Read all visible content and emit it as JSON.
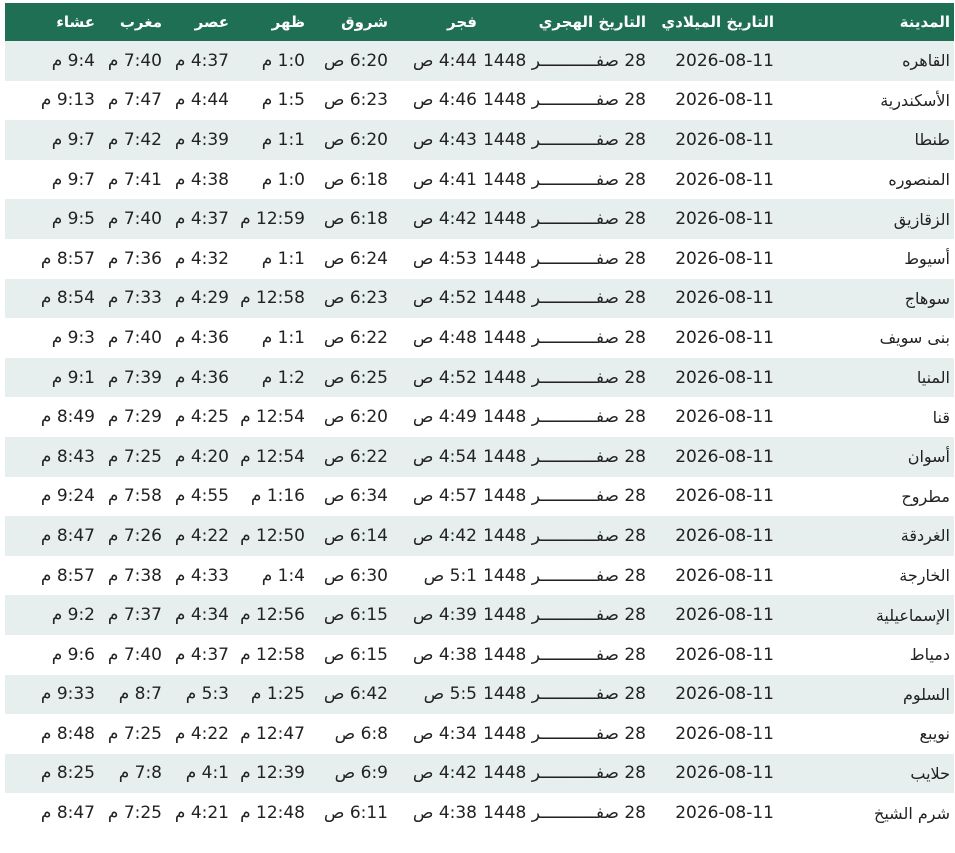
{
  "table": {
    "headers": {
      "city": "المدينة",
      "greg": "التاريخ الميلادي",
      "hijri": "التاريخ الهجري",
      "fajr": "فجر",
      "shuruq": "شروق",
      "dhuhr": "ظهر",
      "asr": "عصر",
      "maghrib": "مغرب",
      "isha": "عشاء"
    },
    "rows": [
      {
        "city": "القاهره",
        "greg": "2026-08-11",
        "hijri": "28 صفـــــــــــر 1448",
        "fajr": "4:44 ص",
        "shuruq": "6:20 ص",
        "dhuhr": "1:0 م",
        "asr": "4:37 م",
        "maghrib": "7:40 م",
        "isha": "9:4 م"
      },
      {
        "city": "الأسكندرية",
        "greg": "2026-08-11",
        "hijri": "28 صفـــــــــــر 1448",
        "fajr": "4:46 ص",
        "shuruq": "6:23 ص",
        "dhuhr": "1:5 م",
        "asr": "4:44 م",
        "maghrib": "7:47 م",
        "isha": "9:13 م"
      },
      {
        "city": "طنطا",
        "greg": "2026-08-11",
        "hijri": "28 صفـــــــــــر 1448",
        "fajr": "4:43 ص",
        "shuruq": "6:20 ص",
        "dhuhr": "1:1 م",
        "asr": "4:39 م",
        "maghrib": "7:42 م",
        "isha": "9:7 م"
      },
      {
        "city": "المنصوره",
        "greg": "2026-08-11",
        "hijri": "28 صفـــــــــــر 1448",
        "fajr": "4:41 ص",
        "shuruq": "6:18 ص",
        "dhuhr": "1:0 م",
        "asr": "4:38 م",
        "maghrib": "7:41 م",
        "isha": "9:7 م"
      },
      {
        "city": "الزقازيق",
        "greg": "2026-08-11",
        "hijri": "28 صفـــــــــــر 1448",
        "fajr": "4:42 ص",
        "shuruq": "6:18 ص",
        "dhuhr": "12:59 م",
        "asr": "4:37 م",
        "maghrib": "7:40 م",
        "isha": "9:5 م"
      },
      {
        "city": "أسيوط",
        "greg": "2026-08-11",
        "hijri": "28 صفـــــــــــر 1448",
        "fajr": "4:53 ص",
        "shuruq": "6:24 ص",
        "dhuhr": "1:1 م",
        "asr": "4:32 م",
        "maghrib": "7:36 م",
        "isha": "8:57 م"
      },
      {
        "city": "سوهاج",
        "greg": "2026-08-11",
        "hijri": "28 صفـــــــــــر 1448",
        "fajr": "4:52 ص",
        "shuruq": "6:23 ص",
        "dhuhr": "12:58 م",
        "asr": "4:29 م",
        "maghrib": "7:33 م",
        "isha": "8:54 م"
      },
      {
        "city": "بنى سويف",
        "greg": "2026-08-11",
        "hijri": "28 صفـــــــــــر 1448",
        "fajr": "4:48 ص",
        "shuruq": "6:22 ص",
        "dhuhr": "1:1 م",
        "asr": "4:36 م",
        "maghrib": "7:40 م",
        "isha": "9:3 م"
      },
      {
        "city": "المنيا",
        "greg": "2026-08-11",
        "hijri": "28 صفـــــــــــر 1448",
        "fajr": "4:52 ص",
        "shuruq": "6:25 ص",
        "dhuhr": "1:2 م",
        "asr": "4:36 م",
        "maghrib": "7:39 م",
        "isha": "9:1 م"
      },
      {
        "city": "قنا",
        "greg": "2026-08-11",
        "hijri": "28 صفـــــــــــر 1448",
        "fajr": "4:49 ص",
        "shuruq": "6:20 ص",
        "dhuhr": "12:54 م",
        "asr": "4:25 م",
        "maghrib": "7:29 م",
        "isha": "8:49 م"
      },
      {
        "city": "أسوان",
        "greg": "2026-08-11",
        "hijri": "28 صفـــــــــــر 1448",
        "fajr": "4:54 ص",
        "shuruq": "6:22 ص",
        "dhuhr": "12:54 م",
        "asr": "4:20 م",
        "maghrib": "7:25 م",
        "isha": "8:43 م"
      },
      {
        "city": "مطروح",
        "greg": "2026-08-11",
        "hijri": "28 صفـــــــــــر 1448",
        "fajr": "4:57 ص",
        "shuruq": "6:34 ص",
        "dhuhr": "1:16 م",
        "asr": "4:55 م",
        "maghrib": "7:58 م",
        "isha": "9:24 م"
      },
      {
        "city": "الغردقة",
        "greg": "2026-08-11",
        "hijri": "28 صفـــــــــــر 1448",
        "fajr": "4:42 ص",
        "shuruq": "6:14 ص",
        "dhuhr": "12:50 م",
        "asr": "4:22 م",
        "maghrib": "7:26 م",
        "isha": "8:47 م"
      },
      {
        "city": "الخارجة",
        "greg": "2026-08-11",
        "hijri": "28 صفـــــــــــر 1448",
        "fajr": "5:1 ص",
        "shuruq": "6:30 ص",
        "dhuhr": "1:4 م",
        "asr": "4:33 م",
        "maghrib": "7:38 م",
        "isha": "8:57 م"
      },
      {
        "city": "الإسماعيلية",
        "greg": "2026-08-11",
        "hijri": "28 صفـــــــــــر 1448",
        "fajr": "4:39 ص",
        "shuruq": "6:15 ص",
        "dhuhr": "12:56 م",
        "asr": "4:34 م",
        "maghrib": "7:37 م",
        "isha": "9:2 م"
      },
      {
        "city": "دمياط",
        "greg": "2026-08-11",
        "hijri": "28 صفـــــــــــر 1448",
        "fajr": "4:38 ص",
        "shuruq": "6:15 ص",
        "dhuhr": "12:58 م",
        "asr": "4:37 م",
        "maghrib": "7:40 م",
        "isha": "9:6 م"
      },
      {
        "city": "السلوم",
        "greg": "2026-08-11",
        "hijri": "28 صفـــــــــــر 1448",
        "fajr": "5:5 ص",
        "shuruq": "6:42 ص",
        "dhuhr": "1:25 م",
        "asr": "5:3 م",
        "maghrib": "8:7 م",
        "isha": "9:33 م"
      },
      {
        "city": "نويبع",
        "greg": "2026-08-11",
        "hijri": "28 صفـــــــــــر 1448",
        "fajr": "4:34 ص",
        "shuruq": "6:8 ص",
        "dhuhr": "12:47 م",
        "asr": "4:22 م",
        "maghrib": "7:25 م",
        "isha": "8:48 م"
      },
      {
        "city": "حلايب",
        "greg": "2026-08-11",
        "hijri": "28 صفـــــــــــر 1448",
        "fajr": "4:42 ص",
        "shuruq": "6:9 ص",
        "dhuhr": "12:39 م",
        "asr": "4:1 م",
        "maghrib": "7:8 م",
        "isha": "8:25 م"
      },
      {
        "city": "شرم الشيخ",
        "greg": "2026-08-11",
        "hijri": "28 صفـــــــــــر 1448",
        "fajr": "4:38 ص",
        "shuruq": "6:11 ص",
        "dhuhr": "12:48 م",
        "asr": "4:21 م",
        "maghrib": "7:25 م",
        "isha": "8:47 م"
      }
    ]
  }
}
